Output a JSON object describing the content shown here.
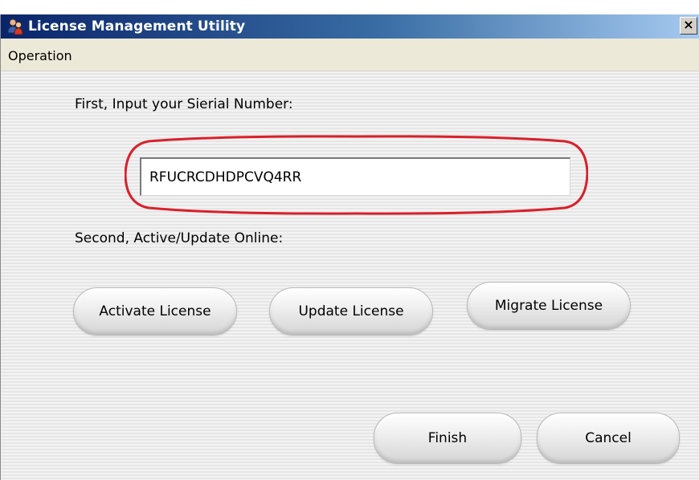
{
  "window": {
    "title": "License Management Utility",
    "close_glyph": "×"
  },
  "menubar": {
    "items": [
      {
        "label": "Operation"
      }
    ]
  },
  "step1": {
    "label": "First, Input your Sierial Number:"
  },
  "serial": {
    "value": "RFUCRCDHDPCVQ4RR"
  },
  "step2": {
    "label": "Second, Active/Update Online:"
  },
  "buttons": {
    "activate": "Activate License",
    "update": "Update License",
    "migrate": "Migrate License",
    "finish": "Finish",
    "cancel": "Cancel"
  },
  "icons": {
    "app": "users-icon",
    "close": "close-icon"
  },
  "colors": {
    "highlight": "#d9202a",
    "titlebar_start": "#0a246a",
    "titlebar_end": "#a6caf0"
  }
}
